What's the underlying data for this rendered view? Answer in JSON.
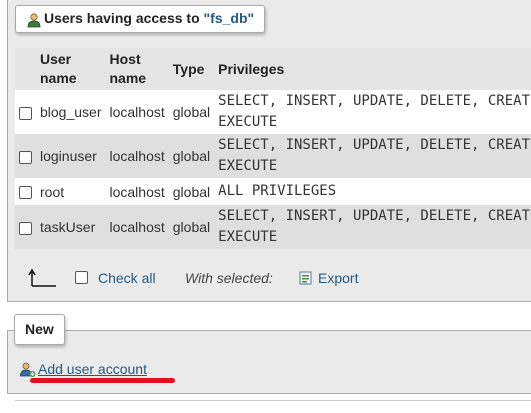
{
  "panel": {
    "title_prefix": "Users having access to ",
    "title_db": "\"fs_db\""
  },
  "table": {
    "headers": {
      "user_line1": "User",
      "user_line2": "name",
      "host_line1": "Host",
      "host_line2": "name",
      "type": "Type",
      "privileges": "Privileges"
    },
    "rows": [
      {
        "user": "blog_user",
        "host": "localhost",
        "type": "global",
        "priv_line1": "SELECT, INSERT, UPDATE, DELETE, CREATE",
        "priv_line2": "EXECUTE"
      },
      {
        "user": "loginuser",
        "host": "localhost",
        "type": "global",
        "priv_line1": "SELECT, INSERT, UPDATE, DELETE, CREATE",
        "priv_line2": "EXECUTE"
      },
      {
        "user": "root",
        "host": "localhost",
        "type": "global",
        "priv_line1": "ALL PRIVILEGES",
        "priv_line2": ""
      },
      {
        "user": "taskUser",
        "host": "localhost",
        "type": "global",
        "priv_line1": "SELECT, INSERT, UPDATE, DELETE, CREATE",
        "priv_line2": "EXECUTE"
      }
    ]
  },
  "footer": {
    "check_all": "Check all",
    "with_selected": "With selected:",
    "export": "Export"
  },
  "new_section": {
    "title": "New",
    "add_user": "Add user account"
  },
  "icons": {
    "users": "users-icon",
    "arrow": "arrow-up-left-icon",
    "export": "export-icon",
    "add_user": "add-user-icon"
  },
  "colors": {
    "link": "#235a81",
    "highlight": "#e01020"
  }
}
